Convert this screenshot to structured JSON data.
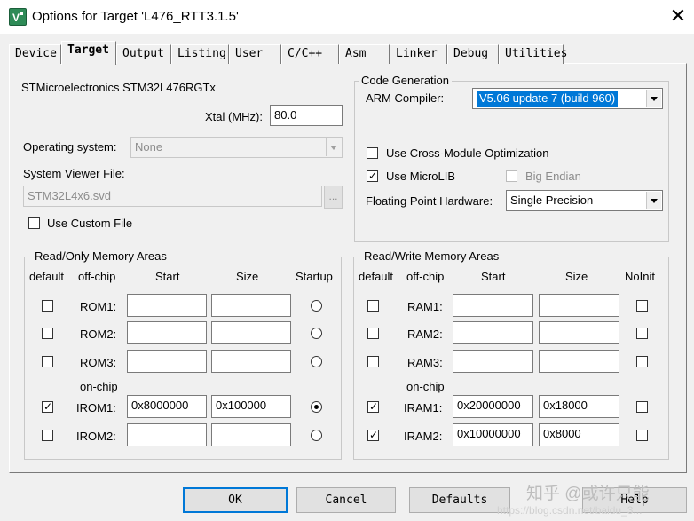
{
  "window": {
    "title": "Options for Target 'L476_RTT3.1.5'",
    "close_glyph": "✕",
    "icon": "keil-uvision-icon"
  },
  "tabs": [
    {
      "label": "Device",
      "active": false
    },
    {
      "label": "Target",
      "active": true
    },
    {
      "label": "Output",
      "active": false
    },
    {
      "label": "Listing",
      "active": false
    },
    {
      "label": "User",
      "active": false
    },
    {
      "label": "C/C++",
      "active": false
    },
    {
      "label": "Asm",
      "active": false
    },
    {
      "label": "Linker",
      "active": false
    },
    {
      "label": "Debug",
      "active": false
    },
    {
      "label": "Utilities",
      "active": false
    }
  ],
  "device": {
    "name": "STMicroelectronics STM32L476RGTx",
    "xtal_label": "Xtal (MHz):",
    "xtal_value": "80.0",
    "os_label": "Operating system:",
    "os_value": "None",
    "svf_label": "System Viewer File:",
    "svf_value": "STM32L4x6.svd",
    "browse_label": "...",
    "custom_file_label": "Use Custom File",
    "custom_file_checked": false
  },
  "code_generation": {
    "title": "Code Generation",
    "compiler_label": "ARM Compiler:",
    "compiler_value": "V5.06 update 7 (build 960)",
    "cross_module_label": "Use Cross-Module Optimization",
    "cross_module_checked": false,
    "microlib_label": "Use MicroLIB",
    "microlib_checked": true,
    "big_endian_label": "Big Endian",
    "big_endian_checked": false,
    "fpu_label": "Floating Point Hardware:",
    "fpu_value": "Single Precision"
  },
  "rom_areas": {
    "title": "Read/Only Memory Areas",
    "headers": {
      "default": "default",
      "offchip": "off-chip",
      "start": "Start",
      "size": "Size",
      "startup": "Startup"
    },
    "onchip_label": "on-chip",
    "rows": [
      {
        "label": "ROM1:",
        "default": false,
        "start": "",
        "size": "",
        "startup": false
      },
      {
        "label": "ROM2:",
        "default": false,
        "start": "",
        "size": "",
        "startup": false
      },
      {
        "label": "ROM3:",
        "default": false,
        "start": "",
        "size": "",
        "startup": false
      },
      {
        "label": "IROM1:",
        "default": true,
        "start": "0x8000000",
        "size": "0x100000",
        "startup": true
      },
      {
        "label": "IROM2:",
        "default": false,
        "start": "",
        "size": "",
        "startup": false
      }
    ]
  },
  "ram_areas": {
    "title": "Read/Write Memory Areas",
    "headers": {
      "default": "default",
      "offchip": "off-chip",
      "start": "Start",
      "size": "Size",
      "noinit": "NoInit"
    },
    "onchip_label": "on-chip",
    "rows": [
      {
        "label": "RAM1:",
        "default": false,
        "start": "",
        "size": "",
        "noinit": false
      },
      {
        "label": "RAM2:",
        "default": false,
        "start": "",
        "size": "",
        "noinit": false
      },
      {
        "label": "RAM3:",
        "default": false,
        "start": "",
        "size": "",
        "noinit": false
      },
      {
        "label": "IRAM1:",
        "default": true,
        "start": "0x20000000",
        "size": "0x18000",
        "noinit": false
      },
      {
        "label": "IRAM2:",
        "default": true,
        "start": "0x10000000",
        "size": "0x8000",
        "noinit": false
      }
    ]
  },
  "buttons": {
    "ok": "OK",
    "cancel": "Cancel",
    "defaults": "Defaults",
    "help": "Help"
  },
  "watermark": {
    "main": "知乎 @或许只能",
    "url": "https://blog.csdn.net/baidu_3..."
  }
}
